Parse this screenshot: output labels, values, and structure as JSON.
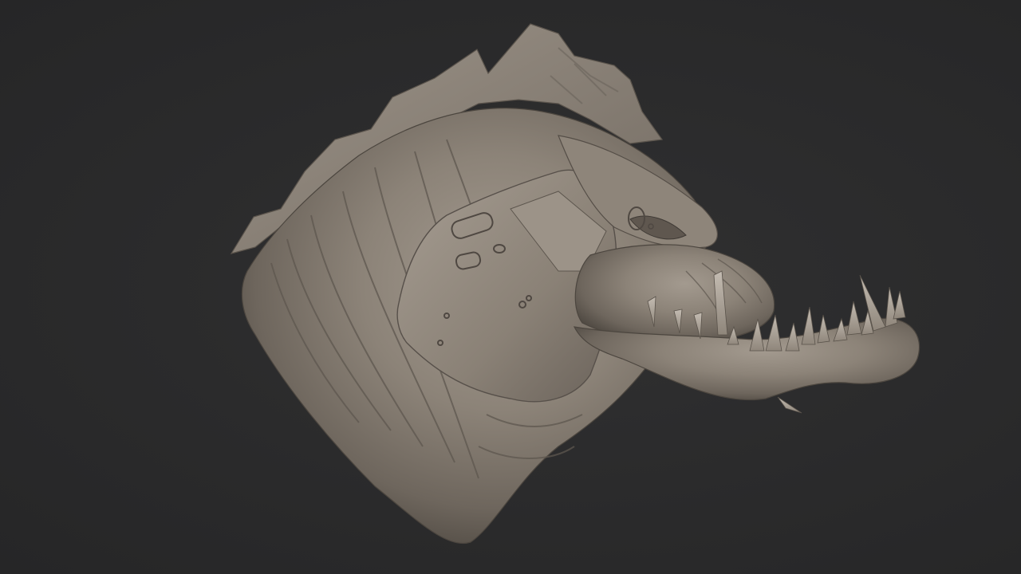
{
  "viewport": {
    "background_color": "#2b2b2c",
    "subject": "creature-head-sculpt",
    "material_color": "#8a7f74"
  }
}
